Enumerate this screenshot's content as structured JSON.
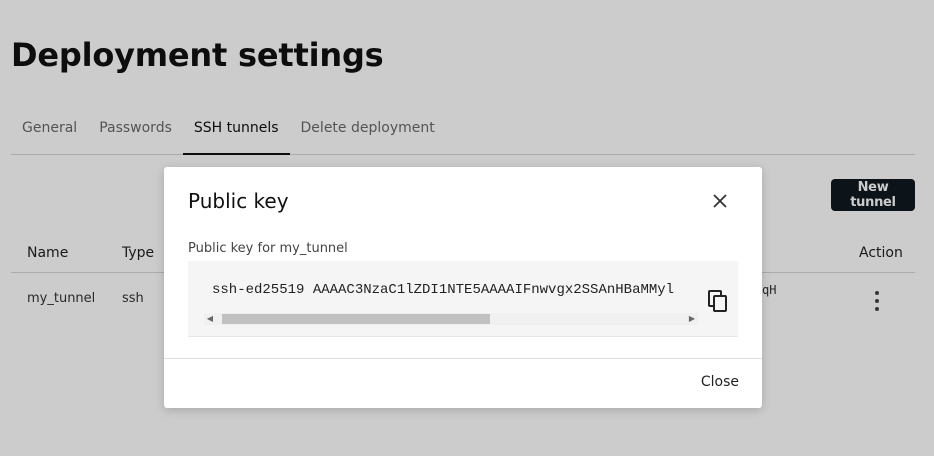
{
  "page": {
    "title": "Deployment settings",
    "tabs": [
      {
        "label": "General",
        "active": false
      },
      {
        "label": "Passwords",
        "active": false
      },
      {
        "label": "SSH tunnels",
        "active": true
      },
      {
        "label": "Delete deployment",
        "active": false
      }
    ],
    "new_tunnel_label": "New tunnel"
  },
  "table": {
    "columns": [
      "Name",
      "Type",
      "Action"
    ],
    "rows": [
      {
        "name": "my_tunnel",
        "type": "ssh",
        "key_fragment": "qH"
      }
    ]
  },
  "modal": {
    "title": "Public key",
    "key_label": "Public key for my_tunnel",
    "public_key": "ssh-ed25519 AAAAC3NzaC1lZDI1NTE5AAAAIFnwvgx2SSAnHBaMMyl",
    "close_label": "Close"
  },
  "icons": {
    "close": "close-icon",
    "copy": "copy-icon",
    "more": "more-vertical-icon",
    "scroll_left": "arrow-left-icon",
    "scroll_right": "arrow-right-icon"
  },
  "colors": {
    "primary_button": "#101820",
    "overlay": "rgba(0,0,0,0.2)"
  }
}
